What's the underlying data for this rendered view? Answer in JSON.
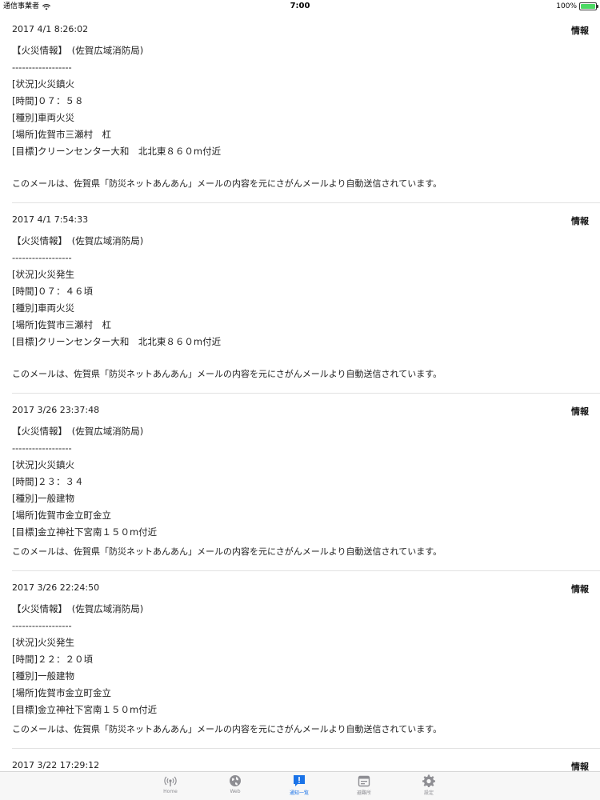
{
  "status_bar": {
    "carrier": "通信事業者",
    "time": "7:00",
    "battery": "100%",
    "battery_level": 100
  },
  "entries": [
    {
      "date": "2017 4/1 8:26:02",
      "tag": "情報",
      "lines": [
        "【火災情報】　(佐賀広域消防局)",
        "------------------",
        "[状況]火災鎮火",
        "[時間]０７：５８",
        "[種別]車両火災",
        "[場所]佐賀市三瀬村　杠",
        "[目標]クリーンセンター大和　北北東８６０m付近"
      ],
      "footer": "このメールは、佐賀県「防災ネットあんあん」メールの内容を元にさがんメールより自動送信されています。"
    },
    {
      "date": "2017 4/1 7:54:33",
      "tag": "情報",
      "lines": [
        "【火災情報】　(佐賀広域消防局)",
        "------------------",
        "[状況]火災発生",
        "[時間]０７：４６頃",
        "[種別]車両火災",
        "[場所]佐賀市三瀬村　杠",
        "[目標]クリーンセンター大和　北北東８６０m付近"
      ],
      "footer": "このメールは、佐賀県「防災ネットあんあん」メールの内容を元にさがんメールより自動送信されています。"
    },
    {
      "date": "2017 3/26 23:37:48",
      "tag": "情報",
      "lines": [
        "【火災情報】　(佐賀広域消防局)",
        "------------------",
        "[状況]火災鎮火",
        "[時間]２３：３４",
        "[種別]一般建物",
        "[場所]佐賀市金立町金立",
        "[目標]金立神社下宮南１５０m付近"
      ],
      "footer": "このメールは、佐賀県「防災ネットあんあん」メールの内容を元にさがんメールより自動送信されています。"
    },
    {
      "date": "2017 3/26 22:24:50",
      "tag": "情報",
      "lines": [
        "【火災情報】　(佐賀広域消防局)",
        "------------------",
        "[状況]火災発生",
        "[時間]２２：２０頃",
        "[種別]一般建物",
        "[場所]佐賀市金立町金立",
        "[目標]金立神社下宮南１５０m付近"
      ],
      "footer": "このメールは、佐賀県「防災ネットあんあん」メールの内容を元にさがんメールより自動送信されています。"
    },
    {
      "date": "2017 3/22 17:29:12",
      "tag": "情報",
      "lines": [],
      "footer": ""
    }
  ],
  "tabs": [
    {
      "label": "Home",
      "icon": "broadcast-icon",
      "active": false
    },
    {
      "label": "Web",
      "icon": "globe-icon",
      "active": false
    },
    {
      "label": "通知一覧",
      "icon": "notification-icon",
      "active": true
    },
    {
      "label": "避難所",
      "icon": "calendar-icon",
      "active": false
    },
    {
      "label": "設定",
      "icon": "gear-icon",
      "active": false
    }
  ],
  "colors": {
    "accent": "#1a73e8",
    "tab_inactive": "#8e8e93",
    "battery": "#4cd964"
  }
}
